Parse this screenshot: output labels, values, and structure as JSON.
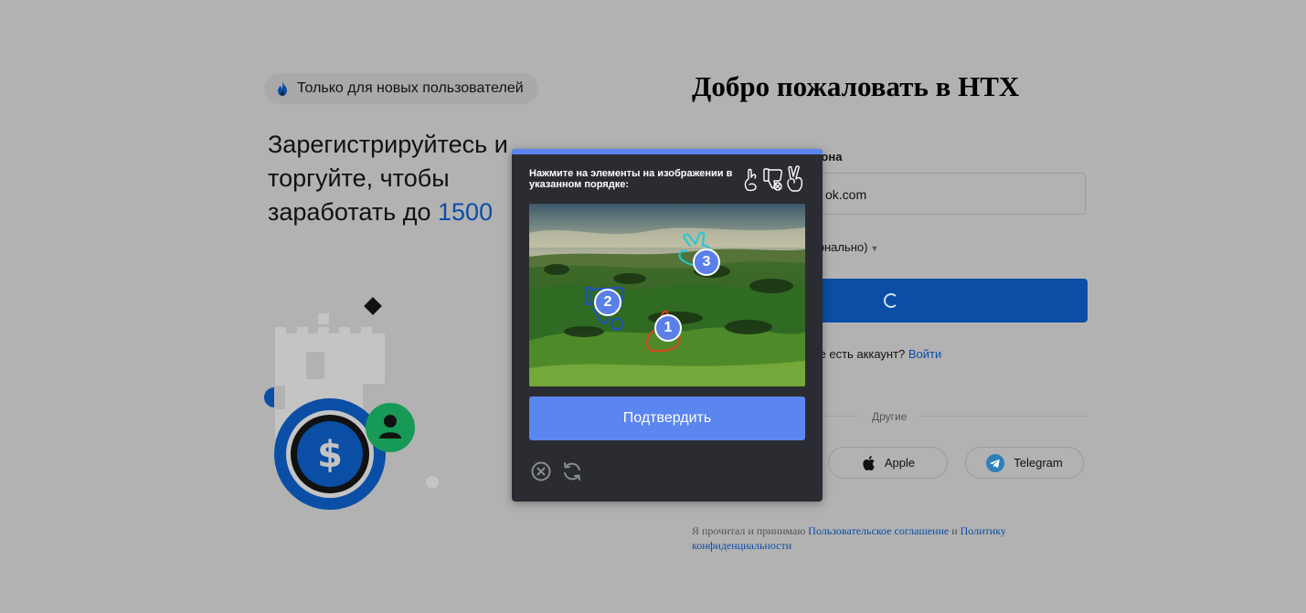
{
  "promo": {
    "badge": "Только для новых пользователей",
    "headline_text": "Зарегистрируйтесь и торгуйте, чтобы заработать до ",
    "headline_accent": "1500"
  },
  "signup": {
    "title": "Добро пожаловать в HTX",
    "field_label": "ефона",
    "field_value": "ok.com",
    "referral_label": "ционально)",
    "login_prompt": "Уже есть аккаунт? ",
    "login_link": "Войти",
    "other_label": "Другие",
    "social": [
      {
        "name": "Apple",
        "icon": "apple-icon"
      },
      {
        "name": "Telegram",
        "icon": "telegram-icon"
      }
    ],
    "terms_prefix": "Я прочитал и принимаю ",
    "terms_link1": "Пользовательское соглашение",
    "terms_and": " и ",
    "terms_link2": "Политику конфиденциальности"
  },
  "captcha": {
    "prompt": "Нажмите на элементы на изображении в указанном порядке:",
    "hint_icons": [
      "hand-crossed-fingers-icon",
      "thumbs-down-icon",
      "hand-peace-icon"
    ],
    "markers": [
      {
        "label": "1",
        "icon": "hand-crossed-fingers-icon"
      },
      {
        "label": "2",
        "icon": "thumbs-down-icon"
      },
      {
        "label": "3",
        "icon": "hand-peace-icon"
      }
    ],
    "confirm_label": "Подтвердить",
    "close_icon": "close-circle-icon",
    "refresh_icon": "refresh-icon",
    "colors": {
      "accent": "#5b86f0",
      "panel": "#2b2c31",
      "brand_blue": "#0a4ea6"
    }
  }
}
